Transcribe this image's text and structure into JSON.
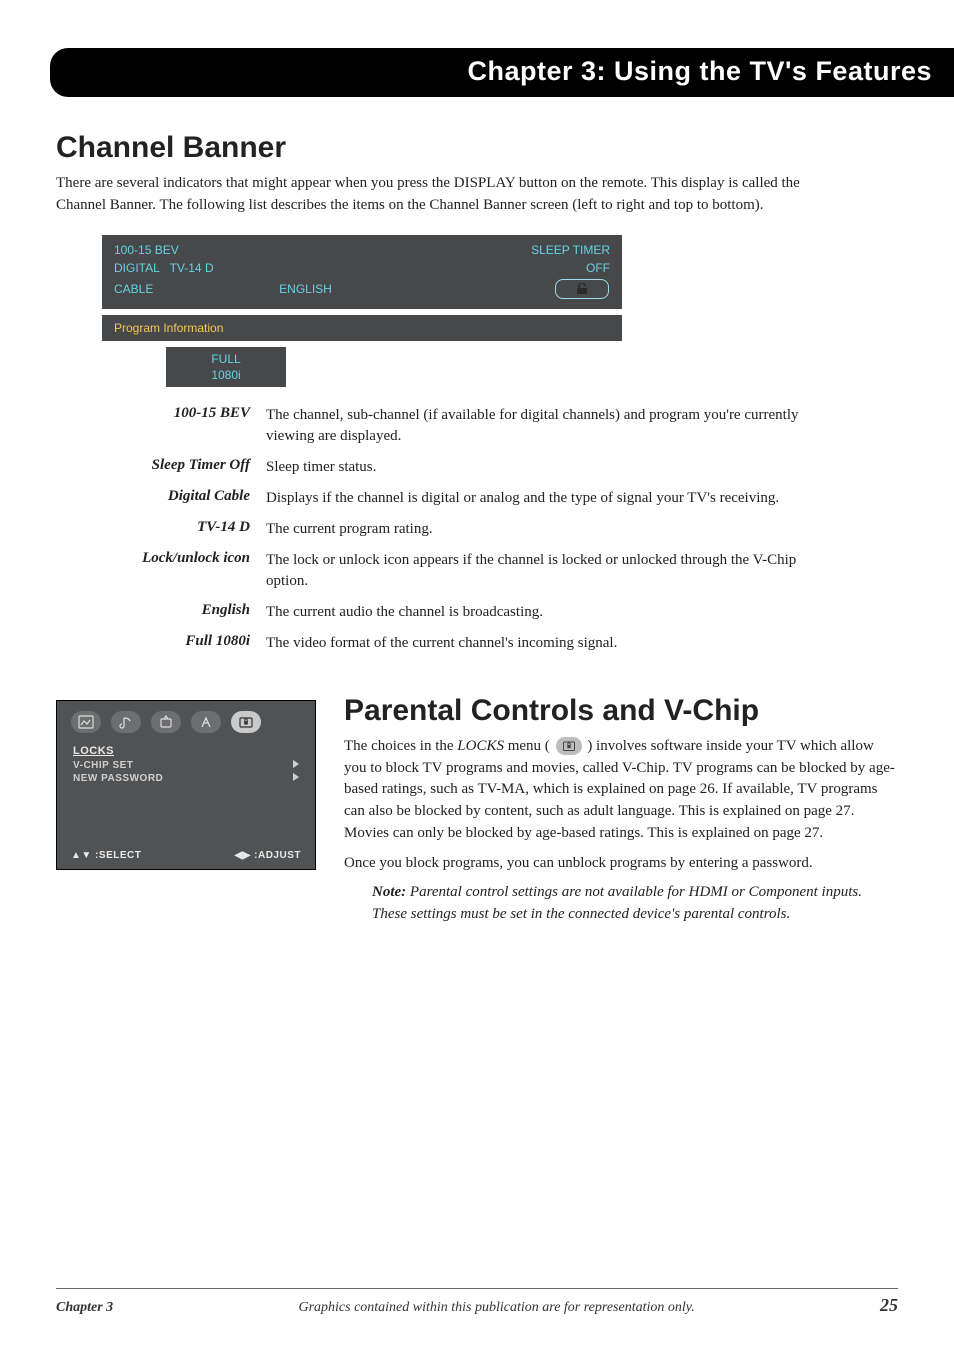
{
  "chapter_bar": "Chapter 3: Using the TV's Features",
  "channel_banner": {
    "title": "Channel Banner",
    "intro": "There are several indicators that might appear when you press the DISPLAY button on the remote. This display is called the Channel Banner. The following list describes the items on the Channel Banner screen (left to right and top to bottom).",
    "osd": {
      "ch": "100-15 BEV",
      "sleep_label": "SLEEP TIMER",
      "digital": "DIGITAL",
      "rating": "TV-14 D",
      "sleep_value": "OFF",
      "cable": "CABLE",
      "lang": "ENGLISH",
      "prog_info": "Program Information",
      "full": "FULL",
      "res": "1080i"
    },
    "defs": [
      {
        "term": "100-15 BEV",
        "desc": "The channel, sub-channel (if available for digital channels) and program you're currently viewing are displayed."
      },
      {
        "term": "Sleep Timer Off",
        "desc": "Sleep timer status."
      },
      {
        "term": "Digital Cable",
        "desc": "Displays if the channel is digital or analog and the type of signal your TV's receiving."
      },
      {
        "term": "TV-14 D",
        "desc": "The current program rating."
      },
      {
        "term": "Lock/unlock icon",
        "desc": "The lock or unlock icon appears if the channel is locked or unlocked through the V-Chip option."
      },
      {
        "term": "English",
        "desc": "The current audio the channel is broadcasting."
      },
      {
        "term": "Full 1080i",
        "desc": "The video format of the current channel's incoming signal."
      }
    ]
  },
  "locks_menu": {
    "heading": "LOCKS",
    "items": [
      "V-CHIP SET",
      "NEW PASSWORD"
    ],
    "footer_left_control": "▲▼",
    "footer_left": ":SELECT",
    "footer_right_control": "◀▶",
    "footer_right": ":ADJUST"
  },
  "parental": {
    "title": "Parental Controls and V-Chip",
    "p1a": "The choices in the ",
    "p1b": "LOCKS",
    "p1c": " menu ( ",
    "p1d": " ) involves software inside your TV which allow you to block TV programs and movies, called V-Chip. TV programs can be blocked by age-based ratings, such as TV-MA, which is explained on page 26. If available, TV programs can also be blocked by content, such as adult language. This is explained on page 27. Movies can only be blocked by age-based ratings. This is explained on page 27.",
    "p2": "Once you block programs, you can unblock programs by entering a password.",
    "note_label": "Note:",
    "note_body": " Parental control settings are not available for HDMI or Component inputs. These settings must be set in the connected device's parental controls."
  },
  "footer": {
    "chapter": "Chapter 3",
    "mid": "Graphics contained within this publication are for representation only.",
    "page": "25"
  }
}
